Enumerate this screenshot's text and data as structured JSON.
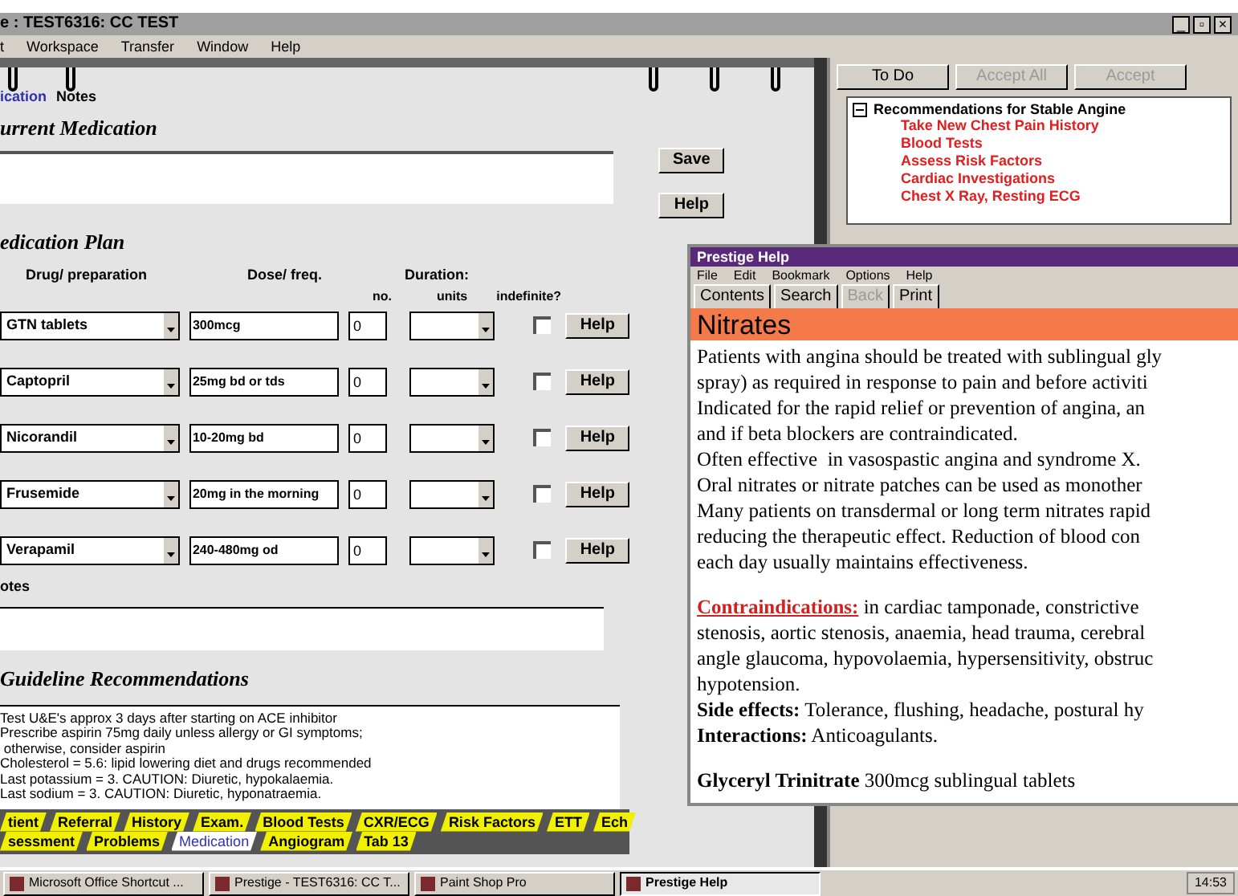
{
  "window": {
    "title": "e : TEST6316: CC TEST",
    "controls": [
      "_",
      "▫",
      "×"
    ]
  },
  "menu": [
    "t",
    "Workspace",
    "Transfer",
    "Window",
    "Help"
  ],
  "notebook_tabs": [
    {
      "label": "ication",
      "selected": true
    },
    {
      "label": "Notes",
      "selected": false
    }
  ],
  "current_medication": {
    "heading": "urrent Medication"
  },
  "side_buttons": [
    "Save",
    "Help"
  ],
  "medication_plan": {
    "heading": "edication Plan",
    "columns": [
      "Drug/ preparation",
      "Dose/ freq.",
      "Duration:"
    ],
    "subcolumns": [
      "no.",
      "units",
      "indefinite?"
    ],
    "rows": [
      {
        "drug": "GTN tablets",
        "dose": "300mcg",
        "no": "0",
        "indefinite": false,
        "help": "Help"
      },
      {
        "drug": "Captopril",
        "dose": "25mg bd or tds",
        "no": "0",
        "indefinite": false,
        "help": "Help"
      },
      {
        "drug": "Nicorandil",
        "dose": "10-20mg bd",
        "no": "0",
        "indefinite": false,
        "help": "Help"
      },
      {
        "drug": "Frusemide",
        "dose": "20mg in the morning",
        "no": "0",
        "indefinite": false,
        "help": "Help"
      },
      {
        "drug": "Verapamil",
        "dose": "240-480mg od",
        "no": "0",
        "indefinite": false,
        "help": "Help"
      }
    ]
  },
  "notes": {
    "label": "otes"
  },
  "guideline": {
    "heading": "Guideline Recommendations",
    "lines": [
      "Test U&E's approx 3 days after starting on ACE inhibitor",
      "Prescribe aspirin 75mg daily unless allergy or GI symptoms;",
      " otherwise, consider aspirin",
      "Cholesterol = 5.6: lipid lowering diet and drugs recommended",
      "Last potassium = 3. CAUTION: Diuretic, hypokalaemia.",
      "Last sodium = 3. CAUTION: Diuretic, hyponatraemia."
    ]
  },
  "bottom_tabs": [
    [
      {
        "label": "tient",
        "selected": false
      },
      {
        "label": "Referral",
        "selected": false
      },
      {
        "label": "History",
        "selected": false
      },
      {
        "label": "Exam.",
        "selected": false
      },
      {
        "label": "Blood Tests",
        "selected": false
      },
      {
        "label": "CXR/ECG",
        "selected": false
      },
      {
        "label": "Risk Factors",
        "selected": false
      },
      {
        "label": "ETT",
        "selected": false
      },
      {
        "label": "Ech",
        "selected": false
      }
    ],
    [
      {
        "label": "sessment",
        "selected": false
      },
      {
        "label": "Problems",
        "selected": false
      },
      {
        "label": "Medication",
        "selected": true
      },
      {
        "label": "Angiogram",
        "selected": false
      },
      {
        "label": "Tab 13",
        "selected": false
      }
    ]
  ],
  "todo": {
    "buttons": [
      {
        "label": "To Do",
        "disabled": false
      },
      {
        "label": "Accept All",
        "disabled": true
      },
      {
        "label": "Accept",
        "disabled": true
      }
    ],
    "tree": {
      "label": "Recommendations for Stable Angine",
      "expanded": true,
      "children": [
        "Take New Chest Pain History",
        "Blood Tests",
        "Assess Risk Factors",
        "Cardiac Investigations",
        "Chest X Ray, Resting ECG"
      ]
    }
  },
  "help_window": {
    "title": "Prestige Help",
    "menu": [
      "File",
      "Edit",
      "Bookmark",
      "Options",
      "Help"
    ],
    "buttons": [
      {
        "label": "Contents",
        "disabled": false
      },
      {
        "label": "Search",
        "disabled": false
      },
      {
        "label": "Back",
        "disabled": true
      },
      {
        "label": "Print",
        "disabled": false
      }
    ],
    "topic": "Nitrates",
    "paragraphs": [
      {
        "kind": "lines",
        "lines": [
          "Patients with angina should be treated with sublingual gly",
          "spray) as required in response to pain and before activiti",
          "Indicated for the rapid relief or prevention of angina, an",
          "and if beta blockers are contraindicated.",
          "Often effective  in vasospastic angina and syndrome X.",
          "Oral nitrates or nitrate patches can be used as monother",
          "Many patients on transdermal or long term nitrates rapid",
          "reducing the therapeutic effect. Reduction of blood con",
          "each day usually maintains effectiveness."
        ]
      },
      {
        "kind": "gap"
      },
      {
        "kind": "link_lines",
        "link": "Contraindications:",
        "lines": [
          " in cardiac tamponade, constrictive",
          "stenosis, aortic stenosis, anaemia, head trauma, cerebral",
          "angle glaucoma, hypovolaemia, hypersensitivity, obstruc",
          "hypotension."
        ]
      },
      {
        "kind": "lines",
        "lines": [
          "**Side effects:** Tolerance, flushing, headache, postural hy",
          "**Interactions:** Anticoagulants."
        ]
      },
      {
        "kind": "gap"
      },
      {
        "kind": "lines",
        "lines": [
          "**Glyceryl Trinitrate** 300mcg sublingual tablets"
        ]
      }
    ]
  },
  "taskbar": {
    "items": [
      {
        "label": "Microsoft Office Shortcut ...",
        "selected": false
      },
      {
        "label": "Prestige - TEST6316: CC T...",
        "selected": false
      },
      {
        "label": "Paint Shop Pro",
        "selected": false
      },
      {
        "label": "Prestige Help",
        "selected": true
      }
    ],
    "time": "14:53"
  }
}
